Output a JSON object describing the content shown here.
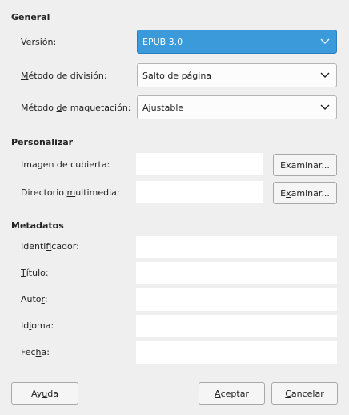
{
  "sections": {
    "general": "General",
    "personalizar": "Personalizar",
    "metadatos": "Metadatos"
  },
  "general": {
    "version": {
      "label_pre": "",
      "label_u": "V",
      "label_post": "ersión:",
      "value": "EPUB 3.0"
    },
    "division": {
      "label_pre": "",
      "label_u": "M",
      "label_post": "étodo de división:",
      "value": "Salto de página"
    },
    "maquetacion": {
      "label_pre": "Método ",
      "label_u": "d",
      "label_post": "e maquetación:",
      "value": "Ajustable"
    }
  },
  "personalizar": {
    "cubierta": {
      "label": "Imagen de cubierta:",
      "value": "",
      "button": "Examinar..."
    },
    "multimedia": {
      "label_pre": "Directorio ",
      "label_u": "m",
      "label_post": "ultimedia:",
      "value": "",
      "button_pre": "E",
      "button_u": "x",
      "button_post": "aminar..."
    }
  },
  "metadatos": {
    "identificador": {
      "label_pre": "Identi",
      "label_u": "f",
      "label_post": "icador:",
      "value": ""
    },
    "titulo": {
      "label_pre": "",
      "label_u": "T",
      "label_post": "ítulo:",
      "value": ""
    },
    "autor": {
      "label_pre": "Auto",
      "label_u": "r",
      "label_post": ":",
      "value": ""
    },
    "idioma": {
      "label_pre": "Id",
      "label_u": "i",
      "label_post": "oma:",
      "value": ""
    },
    "fecha": {
      "label_pre": "Fec",
      "label_u": "h",
      "label_post": "a:",
      "value": ""
    }
  },
  "buttons": {
    "ayuda": {
      "pre": "Ay",
      "u": "u",
      "post": "da"
    },
    "aceptar": {
      "pre": "",
      "u": "A",
      "post": "ceptar"
    },
    "cancelar": {
      "pre": "",
      "u": "C",
      "post": "ancelar"
    }
  },
  "colors": {
    "accent": "#3b9ad9",
    "background": "#efefef"
  }
}
